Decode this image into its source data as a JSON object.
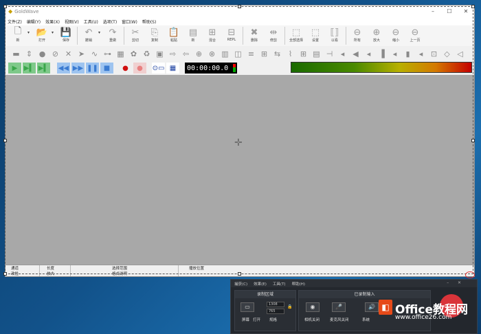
{
  "app": {
    "title": "GoldWave"
  },
  "window_controls": {
    "min": "–",
    "max": "☐",
    "close": "✕"
  },
  "menu": [
    "文件(Z)",
    "编辑(Y)",
    "效果(X)",
    "视图(V)",
    "工具(U)",
    "选项(T)",
    "窗口(W)",
    "帮助(S)"
  ],
  "toolbar1": [
    {
      "label": "新",
      "icon": "🗋",
      "enabled": true,
      "dd": true
    },
    {
      "label": "打开",
      "icon": "📂",
      "enabled": true,
      "dd": true
    },
    {
      "label": "保存",
      "icon": "💾",
      "enabled": false
    },
    {
      "label": "撤销",
      "icon": "↶",
      "enabled": false,
      "dd": true
    },
    {
      "label": "重做",
      "icon": "↷",
      "enabled": false
    },
    {
      "label": "剪切",
      "icon": "✂",
      "enabled": false
    },
    {
      "label": "复制",
      "icon": "⎘",
      "enabled": false
    },
    {
      "label": "粘贴",
      "icon": "📋",
      "enabled": false
    },
    {
      "label": "新",
      "icon": "▤",
      "enabled": false
    },
    {
      "label": "混合",
      "icon": "⊞",
      "enabled": false
    },
    {
      "label": "REPL",
      "icon": "⊟",
      "enabled": false
    },
    {
      "label": "删除",
      "icon": "✖",
      "enabled": false
    },
    {
      "label": "修剪",
      "icon": "⇹",
      "enabled": false
    },
    {
      "label": "全部选择",
      "icon": "⬚",
      "enabled": false
    },
    {
      "label": "设置",
      "icon": "⬚",
      "enabled": false
    },
    {
      "label": "以看",
      "icon": "⟦⟧",
      "enabled": false
    },
    {
      "label": "所有",
      "icon": "⊖",
      "enabled": false
    },
    {
      "label": "放大",
      "icon": "⊕",
      "enabled": false
    },
    {
      "label": "缩小",
      "icon": "⊖",
      "enabled": false
    },
    {
      "label": "上一页",
      "icon": "⊖",
      "enabled": false
    }
  ],
  "toolbar2_icons": [
    "▬",
    "⇕",
    "●",
    "⊘",
    "✕",
    "➤",
    "∿",
    "⊶",
    "▦",
    "✿",
    "♻",
    "▣",
    "⇨",
    "⇦",
    "⊕",
    "⊗",
    "▥",
    "◫",
    "≡",
    "⊞",
    "⇆",
    "⌇",
    "⊞",
    "▤",
    "⊣",
    "◂",
    "◀",
    "◂",
    "▐",
    "◂",
    "▮",
    "◂",
    "⊡",
    "◇",
    "◁"
  ],
  "transport": {
    "buttons": [
      {
        "icon": "▶",
        "color": "#3aa64a",
        "bg": "#7fc98a"
      },
      {
        "icon": "▶▍",
        "color": "#3aa64a",
        "bg": "#7fc98a"
      },
      {
        "icon": "▶▍",
        "color": "#3aa64a",
        "bg": "#7fc98a"
      },
      {
        "icon": "◀◀",
        "color": "#3b7bd1",
        "bg": "#9ec4f0"
      },
      {
        "icon": "▶▶",
        "color": "#3b7bd1",
        "bg": "#9ec4f0"
      },
      {
        "icon": "❚❚",
        "color": "#3b7bd1",
        "bg": "#9ec4f0"
      },
      {
        "icon": "■",
        "color": "#3b7bd1",
        "bg": "#9ec4f0"
      },
      {
        "icon": "●",
        "color": "#d01010",
        "bg": "#f0f0f0"
      },
      {
        "icon": "●",
        "color": "#e88080",
        "bg": "#f0d0d0"
      },
      {
        "icon": "⊙▭",
        "color": "#1a3fa0",
        "bg": "#ffffff"
      },
      {
        "icon": "▦",
        "color": "#1a3fa0",
        "bg": "#ffffff"
      }
    ],
    "time": "00:00:00.0"
  },
  "statusbar": {
    "row1": {
      "c1": "通道",
      "c2": "长度",
      "c3": "选择范围",
      "c4": "播放位置"
    },
    "row2": {
      "c1": "改性",
      "c2": "放大",
      "c3": "格式说明",
      "c4": ""
    }
  },
  "recorder": {
    "menu": [
      "捕获(C)",
      "效果(E)",
      "工具(T)",
      "帮助(H)"
    ],
    "window_controls": {
      "min": "–",
      "close": "✕"
    },
    "section1": {
      "title": "录制区域",
      "screen": "屏幕",
      "open": "打开",
      "size_label": "规格",
      "width": "1308",
      "height": "765"
    },
    "section2": {
      "title": "已录制输入",
      "cam": "相机关闭",
      "mic": "麦克风关闭",
      "sys": "系统"
    }
  },
  "watermark": {
    "name": "Office教程网",
    "url": "www.office26.com"
  }
}
